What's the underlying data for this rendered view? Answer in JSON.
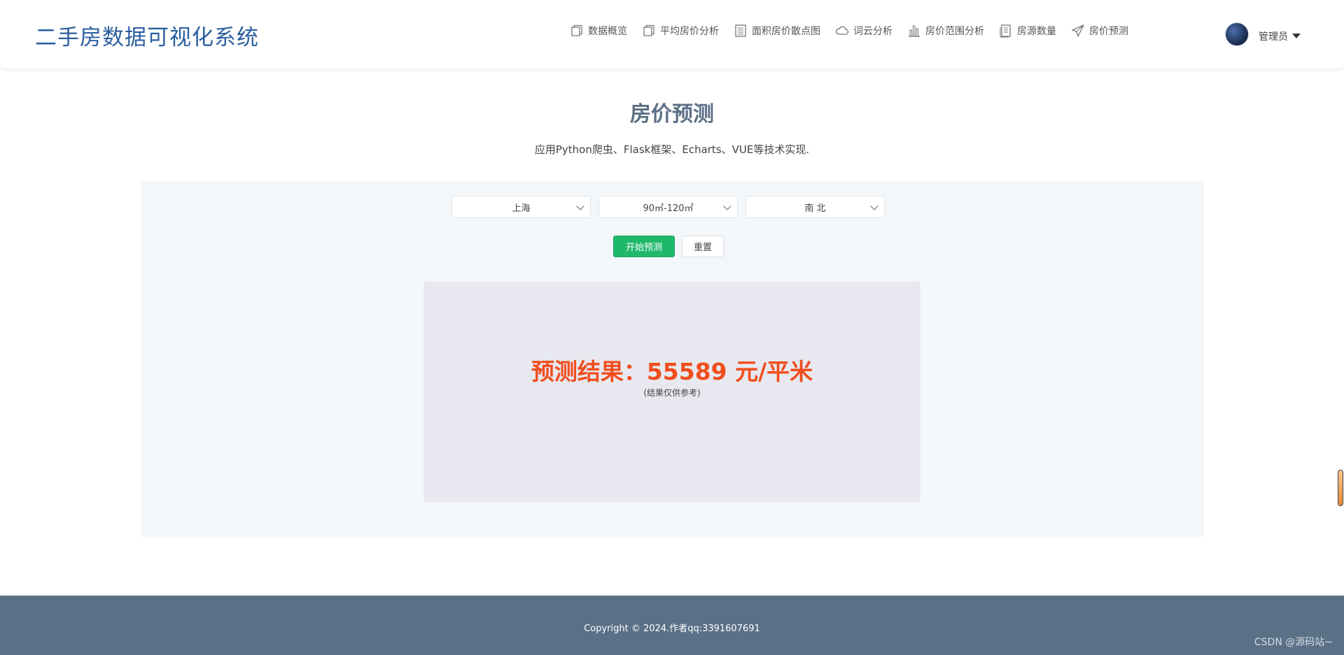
{
  "header": {
    "brand": "二手房数据可视化系统",
    "nav": [
      {
        "label": "数据概览",
        "icon": "copy-icon"
      },
      {
        "label": "平均房价分析",
        "icon": "copy-icon"
      },
      {
        "label": "面积房价散点图",
        "icon": "list-icon"
      },
      {
        "label": "词云分析",
        "icon": "cloud-icon"
      },
      {
        "label": "房价范围分析",
        "icon": "bar-chart-icon"
      },
      {
        "label": "房源数量",
        "icon": "document-icon"
      },
      {
        "label": "房价预测",
        "icon": "paper-plane-icon"
      }
    ],
    "user": {
      "name": "管理员",
      "icon": "avatar"
    }
  },
  "main": {
    "title": "房价预测",
    "subtitle": "应用Python爬虫、Flask框架、Echarts、VUE等技术实现.",
    "selects": [
      {
        "value": "上海"
      },
      {
        "value": "90㎡-120㎡"
      },
      {
        "value": "南 北"
      }
    ],
    "buttons": {
      "predict": "开始预测",
      "reset": "重置"
    },
    "result": {
      "text": "预测结果：55589 元/平米",
      "note": "(结果仅供参考)"
    }
  },
  "footer": {
    "copyright": "Copyright © 2024.作者qq:3391607691",
    "watermark": "CSDN @源码站~"
  },
  "colors": {
    "brand": "#2b5ea0",
    "primary_button": "#1fb86b",
    "result": "#f04e1d",
    "footer_bg": "#5a7087",
    "panel_bg": "#f4f7fa",
    "result_bg": "#e8e8f0"
  }
}
